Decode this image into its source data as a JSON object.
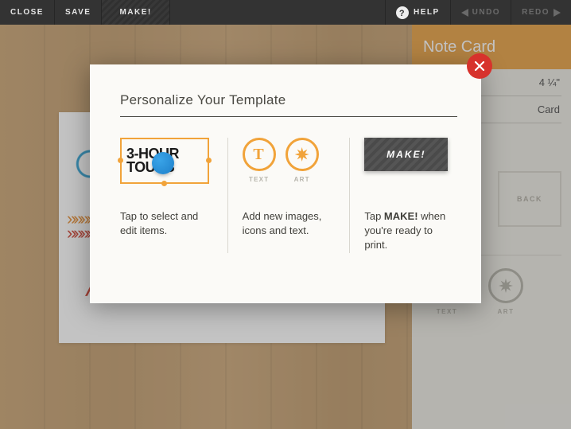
{
  "toolbar": {
    "close": "CLOSE",
    "save": "SAVE",
    "make": "MAKE!",
    "help": "HELP",
    "undo": "UNDO",
    "redo": "REDO"
  },
  "panel": {
    "title": "Note Card",
    "size_field": "4 ¼\"",
    "type_field": "Card",
    "back_label": "BACK",
    "tool_text_label": "TEXT",
    "tool_art_label": "ART"
  },
  "modal": {
    "heading": "Personalize Your Template",
    "col1": {
      "sample_line1": "3-HOUR",
      "sample_line2": "TOURS",
      "caption": "Tap to select and edit items."
    },
    "col2": {
      "text_label": "TEXT",
      "art_label": "ART",
      "caption": "Add new images, icons and text."
    },
    "col3": {
      "make_label": "MAKE!",
      "caption_pre": "Tap ",
      "caption_bold": "MAKE!",
      "caption_post": " when you're ready to print."
    }
  }
}
